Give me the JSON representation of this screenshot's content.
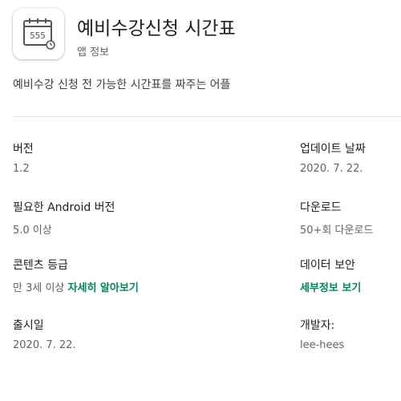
{
  "app": {
    "title": "예비수강신청 시간표",
    "subtitle": "앱 정보",
    "icon": "calendar-schedule-icon",
    "description": "예비수강 신청 전 가능한 시간표를 짜주는 어플"
  },
  "info": {
    "version": {
      "label": "버전",
      "value": "1.2"
    },
    "updated": {
      "label": "업데이트 날짜",
      "value": "2020. 7. 22."
    },
    "android": {
      "label": "필요한 Android 버전",
      "value": "5.0 이상"
    },
    "downloads": {
      "label": "다운로드",
      "value": "50+회 다운로드"
    },
    "rating": {
      "label": "콘텐츠 등급",
      "value": "만 3세 이상",
      "link": "자세히 알아보기"
    },
    "security": {
      "label": "데이터 보안",
      "link": "세부정보 보기"
    },
    "released": {
      "label": "출시일",
      "value": "2020. 7. 22."
    },
    "developer": {
      "label": "개발자:",
      "value": "lee-hees"
    }
  },
  "colors": {
    "accent": "#01875f",
    "text_primary": "#202124",
    "text_secondary": "#5f6368"
  }
}
